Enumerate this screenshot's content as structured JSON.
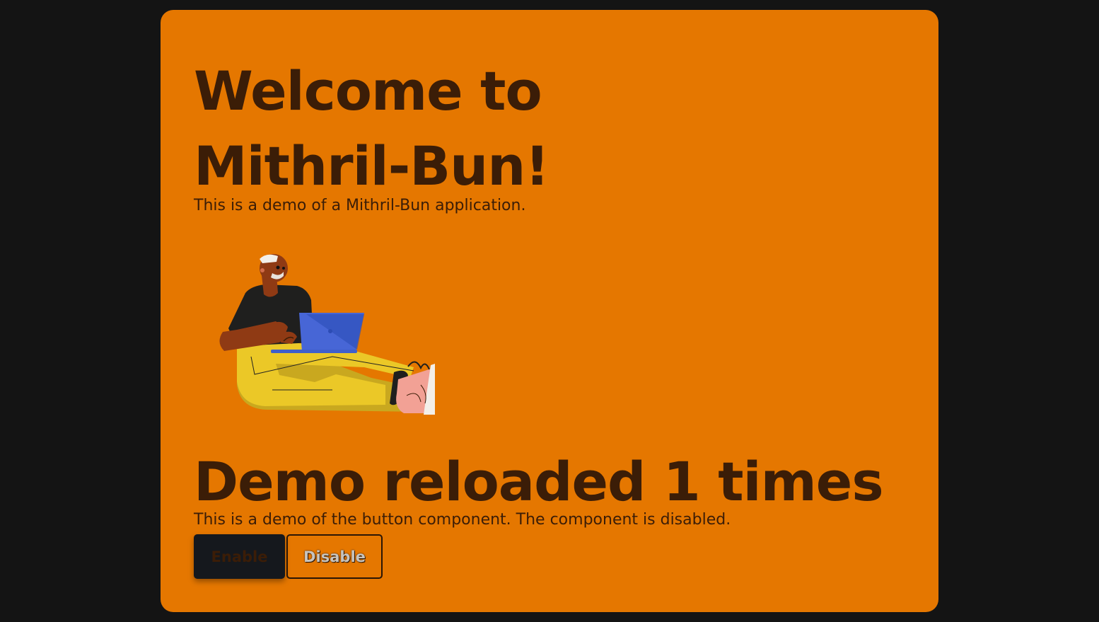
{
  "page": {
    "title": "Welcome to Mithril-Bun!",
    "subtitle": "This is a demo of a Mithril-Bun application.",
    "illustration_alt": "person-with-laptop-illustration"
  },
  "demo": {
    "heading": "Demo reloaded 1 times",
    "description": "This is a demo of the button component. The component is disabled.",
    "enable_label": "Enable",
    "disable_label": "Disable"
  },
  "colors": {
    "background": "#141414",
    "card": "#e57700",
    "text": "#3b1d07",
    "enable_button": "#15181d"
  }
}
